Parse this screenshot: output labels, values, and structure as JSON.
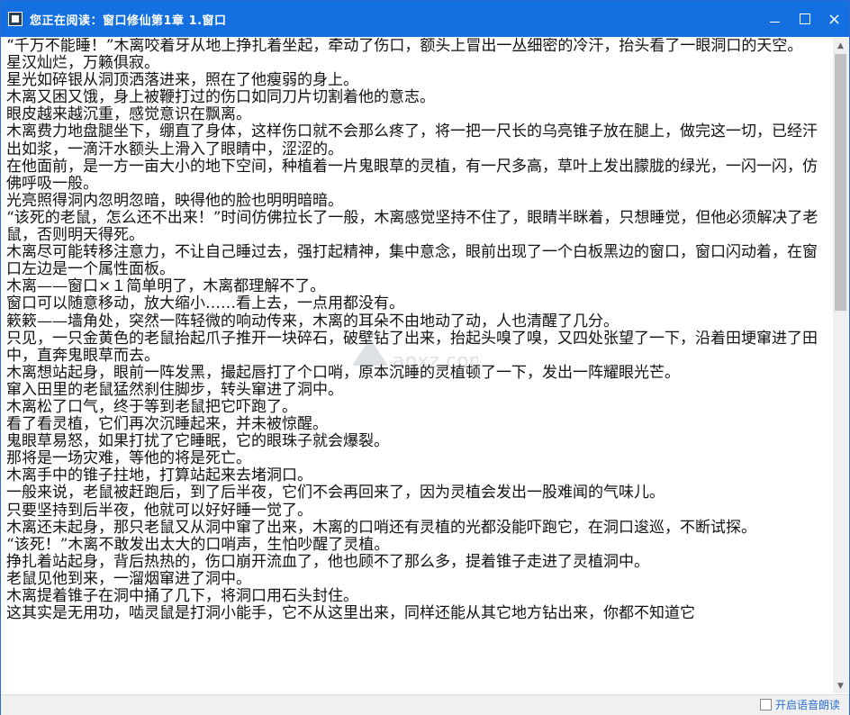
{
  "window": {
    "title": "您正在阅读：窗口修仙第1章 1.窗口",
    "controls": {
      "minimize": "minimize-icon",
      "maximize": "maximize-icon",
      "close": "×"
    }
  },
  "content": {
    "paragraphs": [
      "“千万不能睡！”木离咬着牙从地上挣扎着坐起，牵动了伤口，额头上冒出一丛细密的冷汗，抬头看了一眼洞口的天空。",
      "星汉灿烂，万籁俱寂。",
      "星光如碎银从洞顶洒落进来，照在了他瘦弱的身上。",
      "木离又困又饿，身上被鞭打过的伤口如同刀片切割着他的意志。",
      "眼皮越来越沉重，感觉意识在飘离。",
      "木离费力地盘腿坐下，绷直了身体，这样伤口就不会那么疼了，将一把一尺长的乌亮锥子放在腿上，做完这一切，已经汗出如浆，一滴汗水额头上滑入了眼睛中，涩涩的。",
      "在他面前，是一方一亩大小的地下空间，种植着一片鬼眼草的灵植，有一尺多高，草叶上发出朦胧的绿光，一闪一闪，仿佛呼吸一般。",
      "光亮照得洞内忽明忽暗，映得他的脸也明明暗暗。",
      "“该死的老鼠，怎么还不出来！”时间仿佛拉长了一般，木离感觉坚持不住了，眼睛半眯着，只想睡觉，但他必须解决了老鼠，否则明天得死。",
      "木离尽可能转移注意力，不让自己睡过去，强打起精神，集中意念，眼前出现了一个白板黑边的窗口，窗口闪动着，在窗口左边是一个属性面板。",
      "木离——窗口×１简单明了，木离都理解不了。",
      "窗口可以随意移动，放大缩小……看上去，一点用都没有。",
      "簌簌——墙角处，突然一阵轻微的响动传来，木离的耳朵不由地动了动，人也清醒了几分。",
      "只见，一只金黄色的老鼠抬起爪子推开一块碎石，破壁钻了出来，抬起头嗅了嗅，又四处张望了一下，沿着田埂窜进了田中，直奔鬼眼草而去。",
      "木离想站起身，眼前一阵发黑，撮起唇打了个口哨，原本沉睡的灵植顿了一下，发出一阵耀眼光芒。",
      "窜入田里的老鼠猛然刹住脚步，转头窜进了洞中。",
      "木离松了口气，终于等到老鼠把它吓跑了。",
      "看了看灵植，它们再次沉睡起来，并未被惊醒。",
      "鬼眼草易怒，如果打扰了它睡眠，它的眼珠子就会爆裂。",
      "那将是一场灾难，等他的将是死亡。",
      "木离手中的锥子拄地，打算站起来去堵洞口。",
      "一般来说，老鼠被赶跑后，到了后半夜，它们不会再回来了，因为灵植会发出一股难闻的气味儿。",
      "只要坚持到后半夜，他就可以好好睡一觉了。",
      "木离还未起身，那只老鼠又从洞中窜了出来，木离的口哨还有灵植的光都没能吓跑它，在洞口逡巡，不断试探。",
      "“该死！”木离不敢发出太大的口哨声，生怕吵醒了灵植。",
      "挣扎着站起身，背后热热的，伤口崩开流血了，他也顾不了那么多，提着锥子走进了灵植洞中。",
      "老鼠见他到来，一溜烟窜进了洞中。",
      "木离提着锥子在洞中捅了几下，将洞口用石头封住。",
      "这其实是无用功，啮灵鼠是打洞小能手，它不从这里出来，同样还能从其它地方钻出来，你都不知道它"
    ]
  },
  "statusbar": {
    "tts_label": "开启语音朗读",
    "tts_checked": false
  },
  "watermark": {
    "text": "anxz.com"
  },
  "colors": {
    "titlebar": "#1470e0",
    "link": "#2a6fd1"
  }
}
